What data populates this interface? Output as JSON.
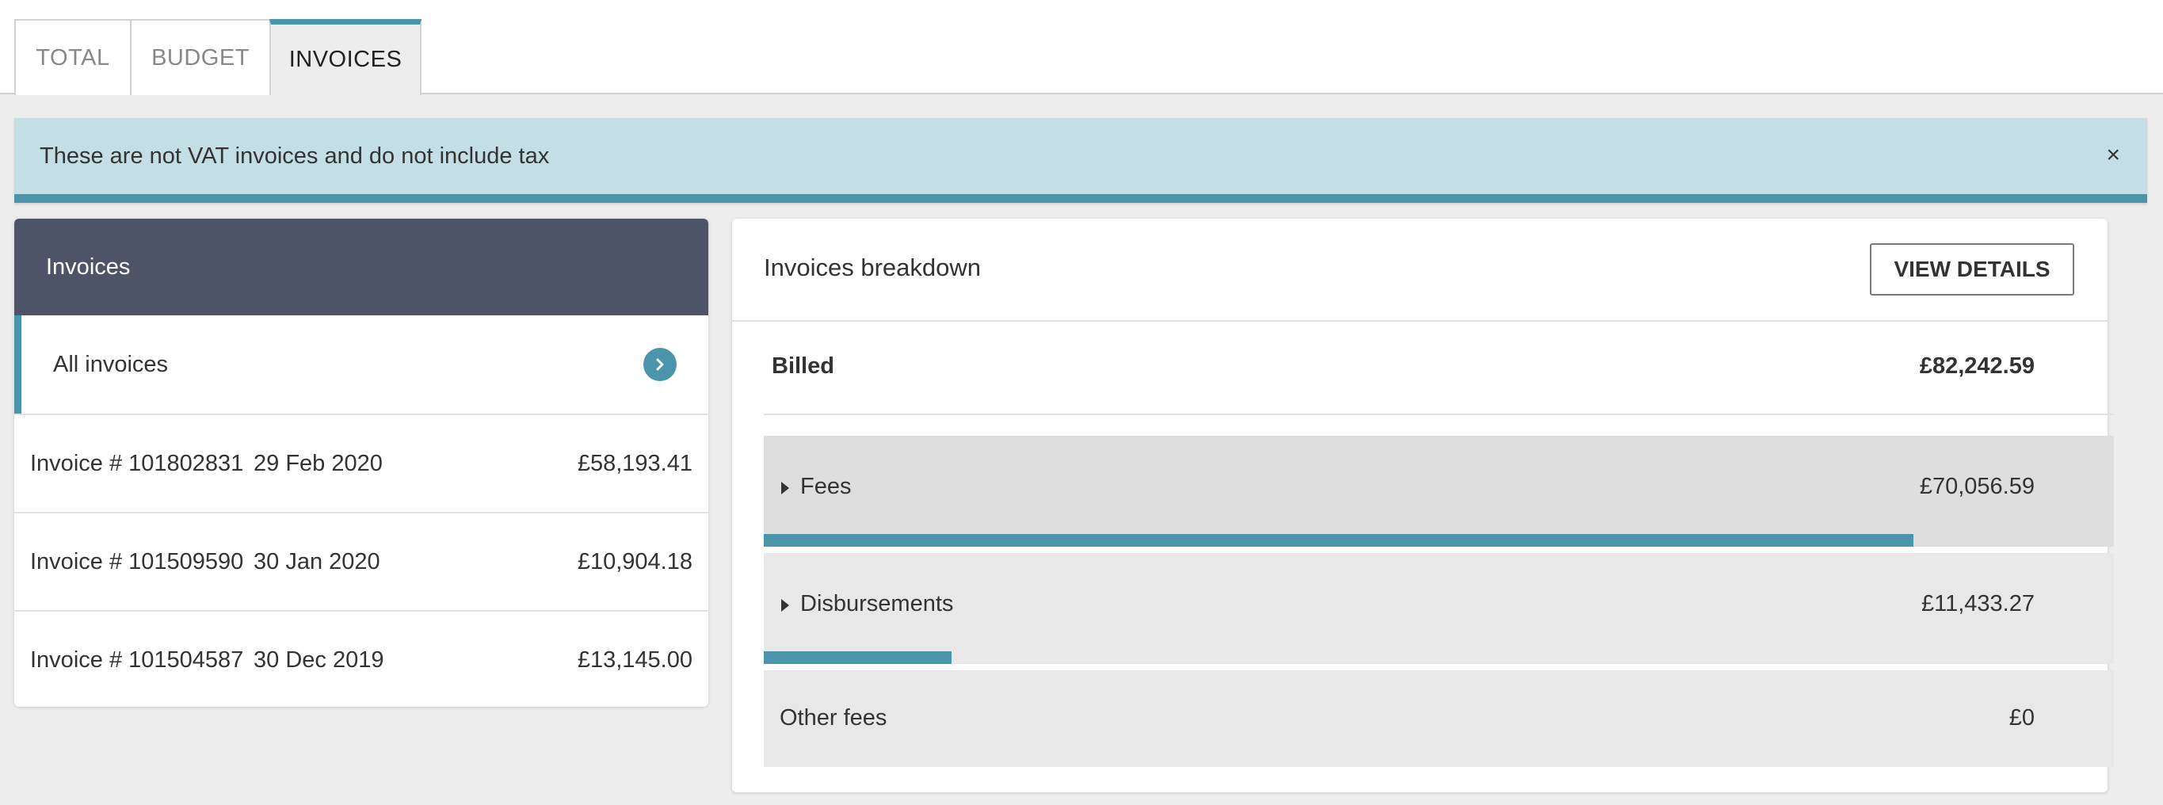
{
  "tabs": {
    "total": "TOTAL",
    "budget": "BUDGET",
    "invoices": "INVOICES",
    "active": "INVOICES"
  },
  "alert": {
    "message": "These are not VAT invoices and do not include tax",
    "close_glyph": "×"
  },
  "invoices_panel": {
    "title": "Invoices",
    "all_label": "All invoices",
    "items": [
      {
        "number": "Invoice # 101802831",
        "date": "29 Feb 2020",
        "amount": "£58,193.41"
      },
      {
        "number": "Invoice # 101509590",
        "date": "30 Jan 2020",
        "amount": "£10,904.18"
      },
      {
        "number": "Invoice # 101504587",
        "date": "30 Dec 2019",
        "amount": "£13,145.00"
      }
    ]
  },
  "breakdown": {
    "title": "Invoices breakdown",
    "view_details_label": "VIEW DETAILS",
    "billed_label": "Billed",
    "billed_amount": "£82,242.59",
    "rows": [
      {
        "label": "Fees",
        "amount": "£70,056.59",
        "share": 0.8518
      },
      {
        "label": "Disbursements",
        "amount": "£11,433.27",
        "share": 0.139
      },
      {
        "label": "Other fees",
        "amount": "£0",
        "share": 0
      }
    ]
  },
  "colors": {
    "accent": "#4a95aa",
    "panel_header": "#4e5468",
    "alert_bg": "#c3dee4"
  }
}
